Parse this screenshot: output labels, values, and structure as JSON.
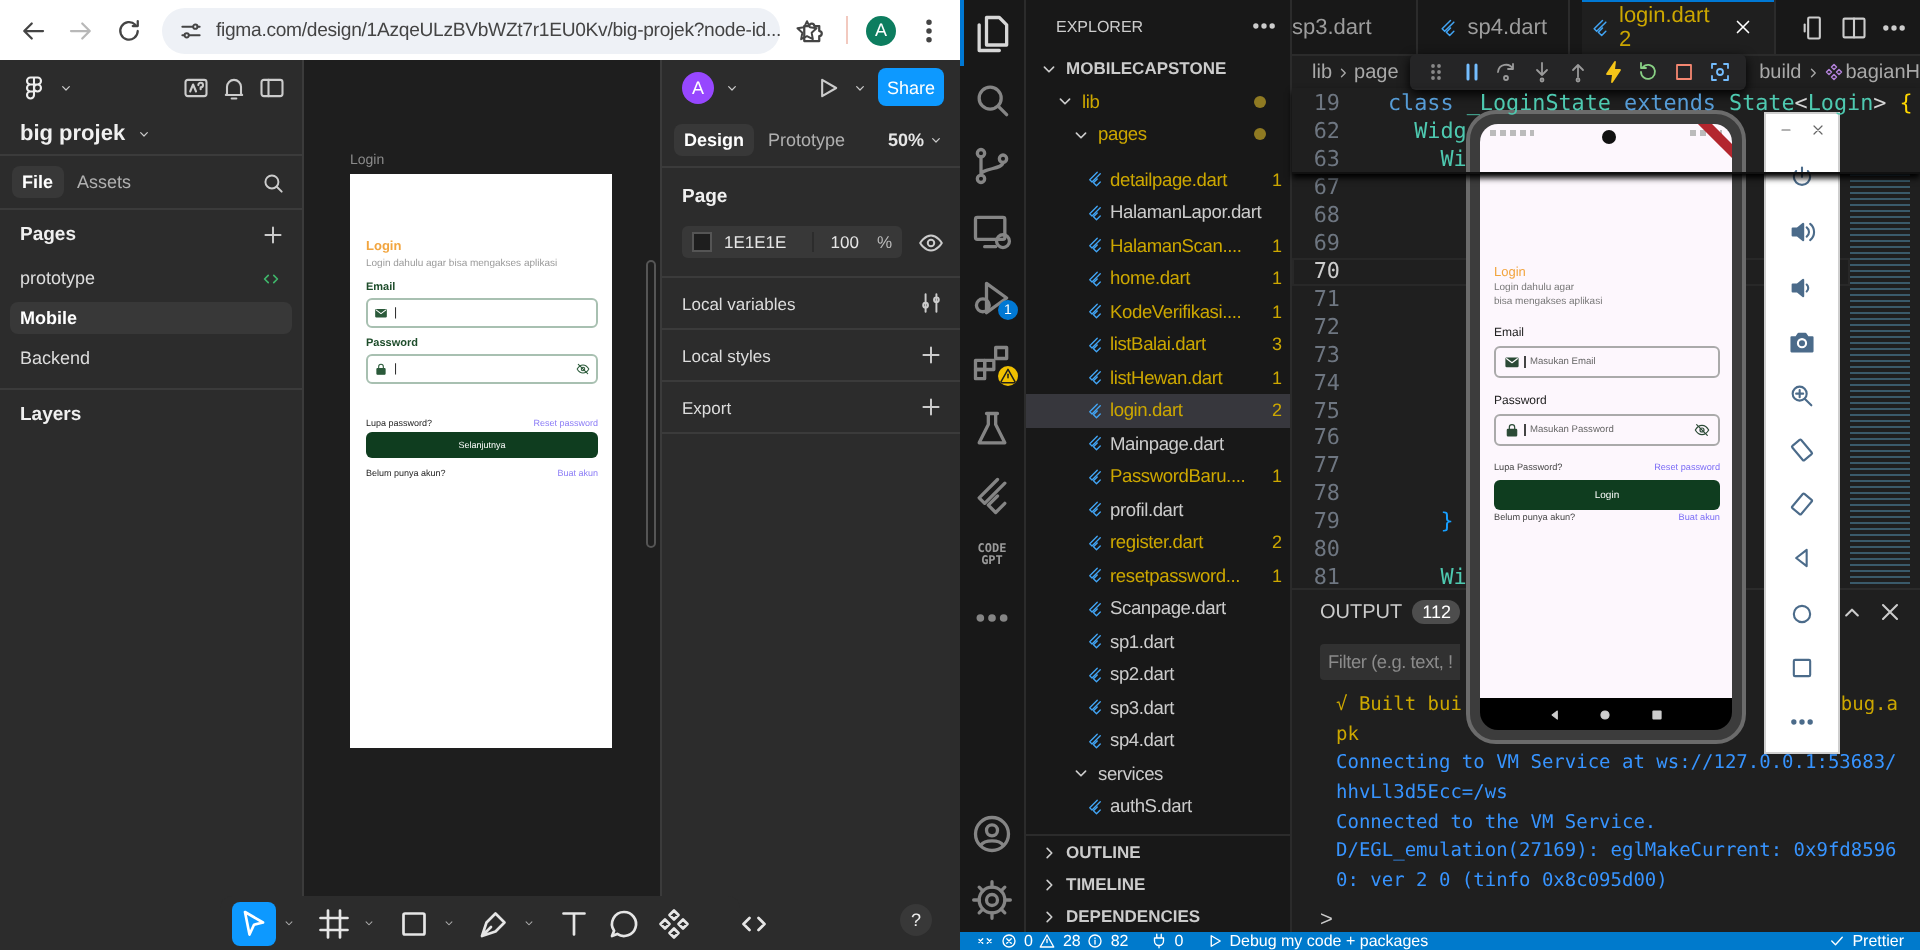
{
  "browser": {
    "url": "figma.com/design/1AzqeULzBVbWZt7r1EU0Kv/big-projek?node-id...",
    "forward_disabled": true,
    "profile_initial": "A"
  },
  "figma": {
    "file_name": "big projek",
    "left_tabs": [
      {
        "label": "File",
        "selected": true
      },
      {
        "label": "Assets",
        "selected": false
      }
    ],
    "pages_heading": "Pages",
    "pages": [
      {
        "label": "prototype",
        "selected": false,
        "dev_mode": true
      },
      {
        "label": "Mobile",
        "selected": true,
        "dev_mode": false
      },
      {
        "label": "Backend",
        "selected": false,
        "dev_mode": false
      }
    ],
    "layers_heading": "Layers",
    "user_initial": "A",
    "share": "Share",
    "right_tabs": [
      {
        "label": "Design",
        "selected": true
      },
      {
        "label": "Prototype",
        "selected": false
      }
    ],
    "zoom": "50%",
    "page_heading": "Page",
    "page_color": "1E1E1E",
    "page_opacity": "100",
    "opacity_unit": "%",
    "sections": [
      {
        "label": "Local variables",
        "kind": "variables"
      },
      {
        "label": "Local styles",
        "kind": "add"
      },
      {
        "label": "Export",
        "kind": "add"
      }
    ],
    "frame": {
      "name": "Login",
      "title": "Login",
      "subtitle": "Login dahulu agar bisa mengakses aplikasi",
      "email_label": "Email",
      "email_value": "|",
      "password_label": "Password",
      "password_value": "|",
      "forgot": "Lupa password?",
      "reset": "Reset password",
      "button": "Selanjutnya",
      "no_account": "Belum punya akun?",
      "signup": "Buat akun"
    },
    "tools": [
      {
        "kind": "move",
        "selected": true,
        "dropdown": true
      },
      {
        "kind": "frame",
        "selected": false,
        "dropdown": true
      },
      {
        "kind": "shape",
        "selected": false,
        "dropdown": true
      },
      {
        "kind": "pen",
        "selected": false,
        "dropdown": true
      },
      {
        "kind": "text",
        "selected": false,
        "dropdown": false
      },
      {
        "kind": "comment",
        "selected": false,
        "dropdown": false
      },
      {
        "kind": "components",
        "selected": false,
        "dropdown": false
      },
      {
        "kind": "dev",
        "selected": false,
        "dropdown": false
      }
    ],
    "help": "?"
  },
  "vscode": {
    "run_badge": "1",
    "codegpt": "CODE\nGPT",
    "tabs": [
      {
        "label": "sp3.dart",
        "selected": false,
        "warning": false
      },
      {
        "label": "sp4.dart",
        "selected": false,
        "warning": false
      },
      {
        "label": "login.dart",
        "count": "2",
        "selected": true,
        "warning": true
      }
    ],
    "explorer": {
      "title": "EXPLORER",
      "project": "MOBILECAPSTONE",
      "tree": [
        {
          "label": "lib",
          "kind": "folder",
          "expanded": true,
          "modified": true,
          "children": [
            {
              "label": "pages",
              "kind": "folder",
              "expanded": true,
              "modified": true,
              "children": [
                {
                  "label": "detailpage.dart",
                  "kind": "file",
                  "count": "1",
                  "warning": true,
                  "selected": false
                },
                {
                  "label": "HalamanLapor.dart",
                  "kind": "file",
                  "warning": false,
                  "selected": false
                },
                {
                  "label": "HalamanScan....",
                  "kind": "file",
                  "count": "1",
                  "warning": true,
                  "selected": false
                },
                {
                  "label": "home.dart",
                  "kind": "file",
                  "count": "1",
                  "warning": true,
                  "selected": false
                },
                {
                  "label": "KodeVerifikasi....",
                  "kind": "file",
                  "count": "1",
                  "warning": true,
                  "selected": false
                },
                {
                  "label": "listBalai.dart",
                  "kind": "file",
                  "count": "3",
                  "warning": true,
                  "selected": false
                },
                {
                  "label": "listHewan.dart",
                  "kind": "file",
                  "count": "1",
                  "warning": true,
                  "selected": false
                },
                {
                  "label": "login.dart",
                  "kind": "file",
                  "count": "2",
                  "warning": true,
                  "selected": true
                },
                {
                  "label": "Mainpage.dart",
                  "kind": "file",
                  "warning": false,
                  "selected": false
                },
                {
                  "label": "PasswordBaru....",
                  "kind": "file",
                  "count": "1",
                  "warning": true,
                  "selected": false
                },
                {
                  "label": "profil.dart",
                  "kind": "file",
                  "warning": false,
                  "selected": false
                },
                {
                  "label": "register.dart",
                  "kind": "file",
                  "count": "2",
                  "warning": true,
                  "selected": false
                },
                {
                  "label": "resetpassword...",
                  "kind": "file",
                  "count": "1",
                  "warning": true,
                  "selected": false
                },
                {
                  "label": "Scanpage.dart",
                  "kind": "file",
                  "warning": false,
                  "selected": false
                },
                {
                  "label": "sp1.dart",
                  "kind": "file",
                  "warning": false,
                  "selected": false
                },
                {
                  "label": "sp2.dart",
                  "kind": "file",
                  "warning": false,
                  "selected": false
                },
                {
                  "label": "sp3.dart",
                  "kind": "file",
                  "warning": false,
                  "selected": false
                },
                {
                  "label": "sp4.dart",
                  "kind": "file",
                  "warning": false,
                  "selected": false
                }
              ]
            },
            {
              "label": "services",
              "kind": "folder",
              "expanded": true,
              "modified": false,
              "children": [
                {
                  "label": "authS.dart",
                  "kind": "file",
                  "warning": false,
                  "selected": false
                }
              ]
            }
          ]
        }
      ],
      "panels": [
        {
          "label": "OUTLINE",
          "expanded": false
        },
        {
          "label": "TIMELINE",
          "expanded": false
        },
        {
          "label": "DEPENDENCIES",
          "expanded": false
        }
      ]
    },
    "breadcrumb_start": [
      "lib",
      "page"
    ],
    "breadcrumb_end": [
      "build",
      "bagianH"
    ],
    "sticky_lines": [
      {
        "number": "19",
        "tokens": [
          {
            "text": "class",
            "kind": "keyword"
          },
          {
            "text": " _LoginState",
            "kind": "type"
          },
          {
            "text": " extends",
            "kind": "keyword"
          },
          {
            "text": " State",
            "kind": "type"
          },
          {
            "text": "<"
          },
          {
            "text": "Login",
            "kind": "type"
          },
          {
            "text": ">"
          },
          {
            "text": " {",
            "kind": "brace"
          }
        ]
      },
      {
        "number": "62",
        "tokens": [
          {
            "text": "  Widg",
            "kind": "type"
          }
        ]
      },
      {
        "number": "63",
        "tokens": [
          {
            "text": "    Wi",
            "kind": "type"
          }
        ]
      }
    ],
    "lines": [
      {
        "number": "67",
        "current": false
      },
      {
        "number": "68",
        "current": false
      },
      {
        "number": "69",
        "current": false
      },
      {
        "number": "70",
        "current": true
      },
      {
        "number": "71",
        "current": false
      },
      {
        "number": "72",
        "current": false
      },
      {
        "number": "73",
        "current": false
      },
      {
        "number": "74",
        "current": false
      },
      {
        "number": "75",
        "current": false
      },
      {
        "number": "76",
        "current": false
      },
      {
        "number": "77",
        "current": false
      },
      {
        "number": "78",
        "current": false
      },
      {
        "number": "79",
        "current": false,
        "tokens": [
          {
            "text": "    }",
            "kind": "brace2"
          }
        ]
      },
      {
        "number": "80",
        "current": false
      },
      {
        "number": "81",
        "current": false,
        "tokens": [
          {
            "text": "    Wi",
            "kind": "type"
          }
        ]
      }
    ],
    "output": {
      "label": "OUTPUT",
      "count": "112",
      "filter_placeholder": "Filter (e.g. text, !",
      "prompt": ">",
      "lines": [
        {
          "left": "√ Built bui",
          "right": "bug.a",
          "kind": "success"
        },
        {
          "left": "pk",
          "kind": "success"
        },
        {
          "left": "Connecting to VM Service at ws://127.0.0.1:53683/",
          "kind": "info"
        },
        {
          "left": "hhvLl3d5Ecc=/ws",
          "kind": "info"
        },
        {
          "left": "Connected to the VM Service.",
          "kind": "info"
        },
        {
          "left": "D/EGL_emulation(27169): eglMakeCurrent: 0x9fd8596",
          "kind": "info"
        },
        {
          "left": "0: ver 2 0 (tinfo 0x8c095d00)",
          "kind": "info"
        }
      ]
    },
    "status_bar": {
      "problems": [
        {
          "kind": "error",
          "count": "0"
        },
        {
          "kind": "warning",
          "count": "28"
        },
        {
          "kind": "info",
          "count": "82"
        }
      ],
      "ports": "0",
      "debug": "Debug my code + packages",
      "formatter": "Prettier"
    }
  },
  "app": {
    "title": "Login",
    "subtitle": "Login dahulu agar\nbisa mengakses aplikasi",
    "email_label": "Email",
    "email_placeholder": "Masukan Email",
    "password_label": "Password",
    "password_placeholder": "Masukan Password",
    "forgot": "Lupa Password?",
    "reset": "Reset password",
    "button": "Login",
    "no_account": "Belum punya akun?",
    "signup": "Buat akun"
  }
}
